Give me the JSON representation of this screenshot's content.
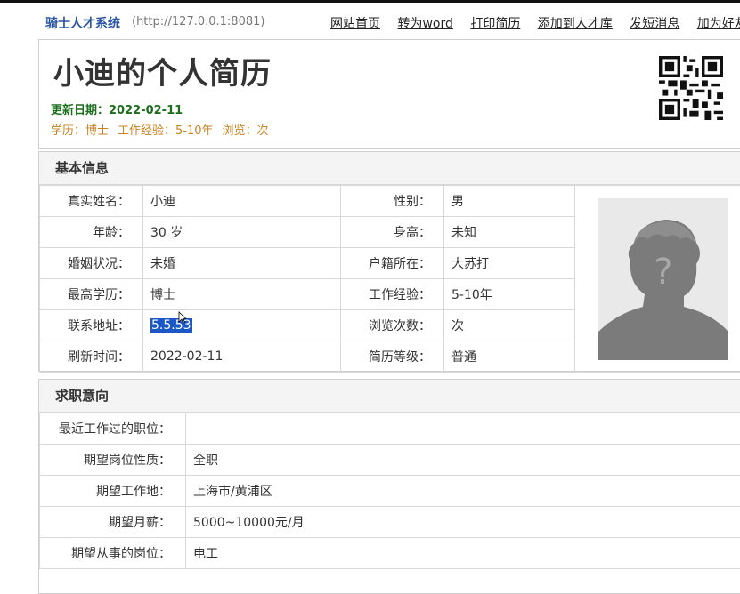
{
  "header": {
    "brand": "骑士人才系统",
    "url": "(http://127.0.0.1:8081)",
    "nav": [
      "网站首页",
      "转为word",
      "打印简历",
      "添加到人才库",
      "发短消息",
      "加为好友"
    ]
  },
  "profile": {
    "title": "小迪的个人简历",
    "updated_label": "更新日期：",
    "updated_value": "2022-02-11",
    "education": "学历：博士",
    "experience": "工作经验：5-10年",
    "views": "浏览：次"
  },
  "basic": {
    "heading": "基本信息",
    "rows": [
      {
        "l1": "真实姓名：",
        "v1": "小迪",
        "l2": "性别：",
        "v2": "男"
      },
      {
        "l1": "年龄：",
        "v1": "30 岁",
        "l2": "身高：",
        "v2": "未知"
      },
      {
        "l1": "婚姻状况：",
        "v1": "未婚",
        "l2": "户籍所在：",
        "v2": "大苏打"
      },
      {
        "l1": "最高学历：",
        "v1": "博士",
        "l2": "工作经验：",
        "v2": "5-10年"
      },
      {
        "l1": "联系地址：",
        "v1": "5.5.53",
        "l2": "浏览次数：",
        "v2": "次"
      },
      {
        "l1": "刷新时间：",
        "v1": "2022-02-11",
        "l2": "简历等级：",
        "v2": "普通"
      }
    ]
  },
  "intent": {
    "heading": "求职意向",
    "rows": [
      {
        "label": "最近工作过的职位：",
        "value": ""
      },
      {
        "label": "期望岗位性质：",
        "value": "全职"
      },
      {
        "label": "期望工作地：",
        "value": "上海市/黄浦区"
      },
      {
        "label": "期望月薪：",
        "value": "5000~10000元/月"
      },
      {
        "label": "期望从事的岗位：",
        "value": "电工"
      }
    ]
  },
  "colors": {
    "brand": "#2a55a0",
    "updated": "#1c6e1c",
    "summary": "#c9821e",
    "selection": "#1a57c7"
  },
  "icons": {
    "qr": "qr-code-icon",
    "photo": "default-avatar-icon"
  }
}
